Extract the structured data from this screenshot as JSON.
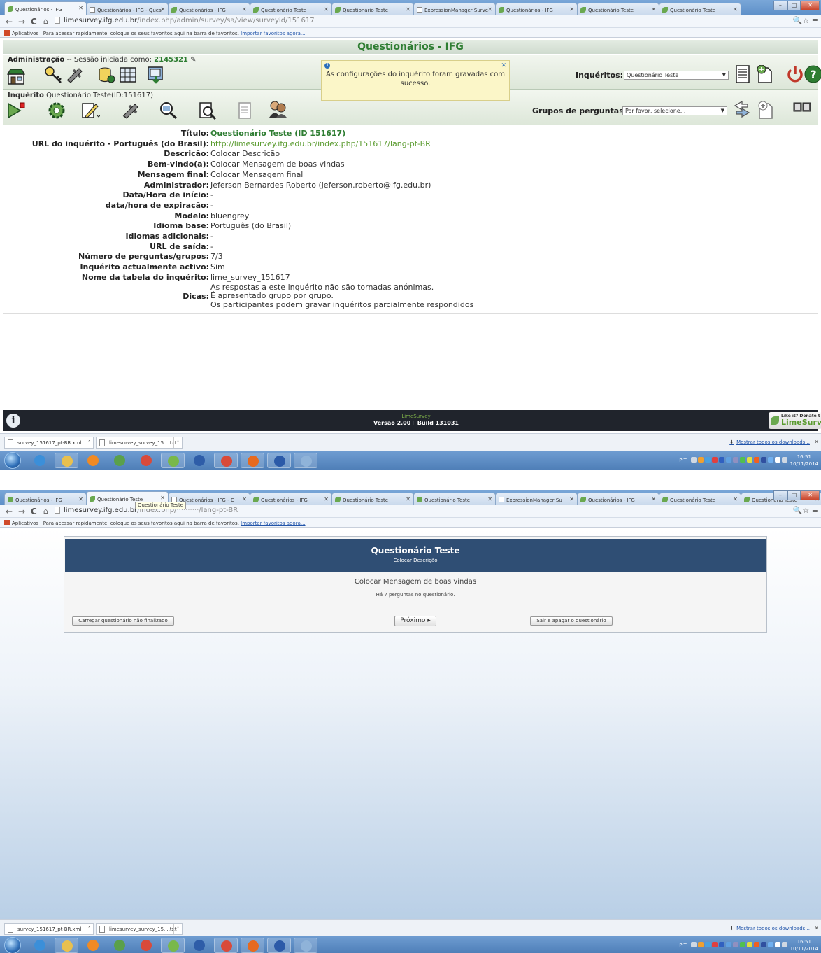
{
  "shot1": {
    "tabs": [
      {
        "label": "Questionários - IFG",
        "icon": "leaf"
      },
      {
        "label": "Questionários - IFG - Ques",
        "icon": "doc"
      },
      {
        "label": "Questionários - IFG",
        "icon": "leaf"
      },
      {
        "label": "Questionário Teste",
        "icon": "leaf"
      },
      {
        "label": "Questionário Teste",
        "icon": "leaf"
      },
      {
        "label": "ExpressionManager Surve",
        "icon": "doc"
      },
      {
        "label": "Questionários - IFG",
        "icon": "leaf"
      },
      {
        "label": "Questionário Teste",
        "icon": "leaf"
      },
      {
        "label": "Questionário Teste",
        "icon": "leaf"
      }
    ],
    "url_host": "limesurvey.ifg.edu.br",
    "url_path": "/index.php/admin/survey/sa/view/surveyid/151617",
    "page_title": "Questionários - IFG",
    "admin_label": "Administração",
    "admin_session": "-- Sessão iniciada como:",
    "admin_user": "2145321",
    "survey_label": "Inquérito",
    "survey_name": "Questionário Teste(ID:151617)",
    "inqueritos_label": "Inquéritos:",
    "inqueritos_value": "Questionário Teste",
    "grupos_label": "Grupos de perguntas:",
    "grupos_value": "Por favor, selecione...",
    "notice": "As configurações do inquérito foram gravadas com sucesso.",
    "details": [
      {
        "k": "Título:",
        "v": "Questionário Teste (ID 151617)"
      },
      {
        "k": "URL do inquérito - Português (do Brasil):",
        "v": "http://limesurvey.ifg.edu.br/index.php/151617/lang-pt-BR"
      },
      {
        "k": "Descrição:",
        "v": "Colocar Descrição"
      },
      {
        "k": "Bem-vindo(a):",
        "v": "Colocar Mensagem de boas vindas"
      },
      {
        "k": "Mensagem final:",
        "v": "Colocar Mensagem final"
      },
      {
        "k": "Administrador:",
        "v": "Jeferson Bernardes Roberto (jeferson.roberto@ifg.edu.br)"
      },
      {
        "k": "Data/Hora de início:",
        "v": "-"
      },
      {
        "k": "data/hora de expiração:",
        "v": "-"
      },
      {
        "k": "Modelo:",
        "v": "bluengrey"
      },
      {
        "k": "Idioma base:",
        "v": "Português (do Brasil)"
      },
      {
        "k": "Idiomas adicionais:",
        "v": "-"
      },
      {
        "k": "URL de saída:",
        "v": "-"
      },
      {
        "k": "Número de perguntas/grupos:",
        "v": "7/3"
      },
      {
        "k": "Inquérito actualmente activo:",
        "v": "Sim"
      },
      {
        "k": "Nome da tabela do inquérito:",
        "v": "lime_survey_151617"
      }
    ],
    "dicas_label": "Dicas:",
    "dicas": [
      "As respostas a este inquérito não são tornadas anónimas.",
      "É apresentado grupo por grupo.",
      "Os participantes podem gravar inquéritos parcialmente respondidos"
    ],
    "footer_brand": "LimeSurvey",
    "footer_version": "Versão 2.00+ Build 131031",
    "donate_small": "Like it? Donate t",
    "donate_big": "LimeSurve"
  },
  "shot2": {
    "tabs": [
      {
        "label": "Questionários - IFG",
        "icon": "leaf"
      },
      {
        "label": "Questionário Teste",
        "icon": "leaf"
      },
      {
        "label": "Questionários - IFG - C",
        "icon": "doc"
      },
      {
        "label": "Questionários - IFG",
        "icon": "leaf"
      },
      {
        "label": "Questionário Teste",
        "icon": "leaf"
      },
      {
        "label": "Questionário Teste",
        "icon": "leaf"
      },
      {
        "label": "ExpressionManager Su",
        "icon": "doc"
      },
      {
        "label": "Questionários - IFG",
        "icon": "leaf"
      },
      {
        "label": "Questionário Teste",
        "icon": "leaf"
      },
      {
        "label": "Questionário Teste",
        "icon": "leaf"
      }
    ],
    "url_host": "limesurvey.ifg.edu.br",
    "url_path_dim": "/index.php/",
    "url_path_end": "/lang-pt-BR",
    "tooltip": "Questionário Teste",
    "survey_title": "Questionário Teste",
    "survey_desc": "Colocar Descrição",
    "welcome": "Colocar Mensagem de boas vindas",
    "qcount": "Há 7 perguntas no questionário.",
    "btn_load": "Carregar questionário não finalizado",
    "btn_next": "Próximo ▸",
    "btn_exit": "Sair e apagar o questionário"
  },
  "bookmarks": {
    "apps": "Aplicativos",
    "hint": "Para acessar rapidamente, coloque os seus favoritos aqui na barra de favoritos.",
    "import": "Importar favoritos agora..."
  },
  "downloads": {
    "file1": "survey_151617_pt-BR.xml",
    "file2": "limesurvey_survey_15....txt",
    "show_all": "Mostrar todos os downloads..."
  },
  "clock": {
    "time": "16:51",
    "date": "10/11/2014",
    "lang": "PT"
  }
}
